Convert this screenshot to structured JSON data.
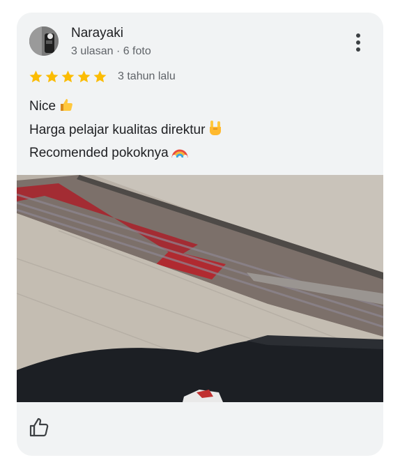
{
  "review": {
    "author": {
      "name": "Narayaki",
      "meta": "3 ulasan · 6 foto",
      "avatar_icon": "user-photo-avatar"
    },
    "rating": {
      "stars": 5,
      "max_stars": 5,
      "date": "3 tahun lalu"
    },
    "text_lines": [
      "Nice",
      "Harga pelajar kualitas direktur",
      "Recomended pokoknya"
    ],
    "emojis": [
      "thumbs-up-emoji",
      "rock-on-emoji",
      "rainbow-emoji"
    ],
    "photo": {
      "icon": "review-photo"
    },
    "actions": {
      "more_icon": "more-vertical-icon",
      "like_icon": "thumbs-up-icon"
    }
  },
  "colors": {
    "card_bg": "#f1f3f4",
    "star": "#fbbc04",
    "text_primary": "#202124",
    "text_secondary": "#5f6368"
  }
}
